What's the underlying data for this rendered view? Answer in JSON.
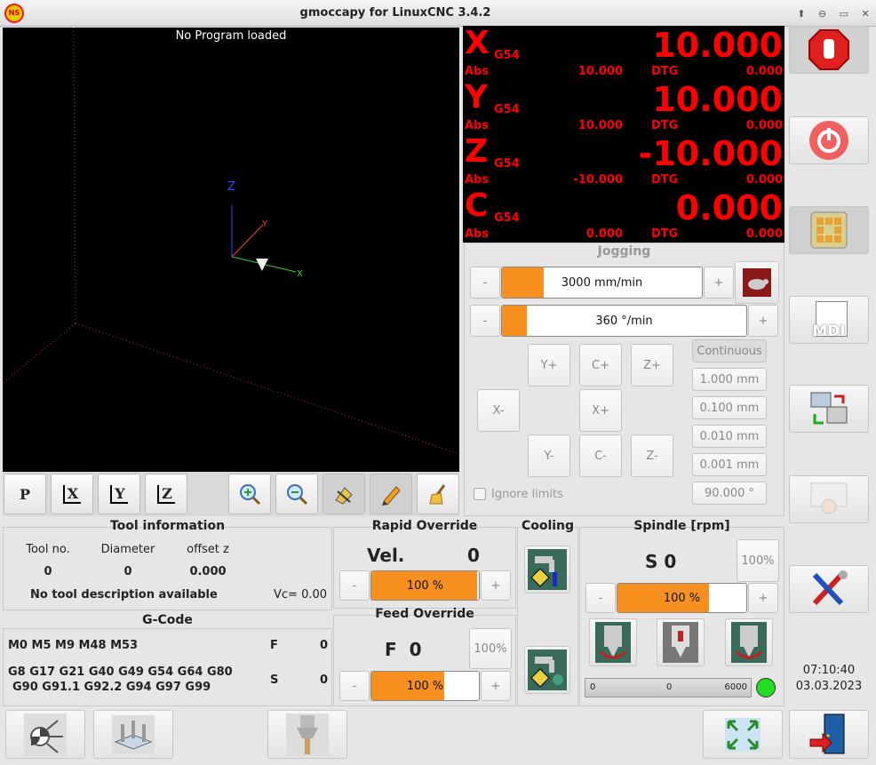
{
  "window": {
    "title": "gmoccapy for LinuxCNC  3.4.2",
    "app_icon": "NS",
    "controls": [
      "⬆",
      "⊖",
      "▭",
      "✕"
    ]
  },
  "preview": {
    "status": "No Program loaded",
    "axis_labels": {
      "z": "Z",
      "y": "Y",
      "x": "X"
    }
  },
  "view_buttons": {
    "perspective": "P",
    "x": "X",
    "y": "Y",
    "z": "Z"
  },
  "dro": [
    {
      "axis": "X",
      "coord": "G54",
      "value": "10.000",
      "abs_label": "Abs",
      "abs": "10.000",
      "dtg_label": "DTG",
      "dtg": "0.000"
    },
    {
      "axis": "Y",
      "coord": "G54",
      "value": "10.000",
      "abs_label": "Abs",
      "abs": "10.000",
      "dtg_label": "DTG",
      "dtg": "0.000"
    },
    {
      "axis": "Z",
      "coord": "G54",
      "value": "-10.000",
      "abs_label": "Abs",
      "abs": "-10.000",
      "dtg_label": "DTG",
      "dtg": "0.000"
    },
    {
      "axis": "C",
      "coord": "G54",
      "value": "0.000",
      "abs_label": "Abs",
      "abs": "0.000",
      "dtg_label": "DTG",
      "dtg": "0.000"
    }
  ],
  "jogging": {
    "title": "Jogging",
    "linear_speed": "3000 mm/min",
    "linear_fill": 0.21,
    "angular_speed": "360 °/min",
    "angular_fill": 0.1,
    "minus": "-",
    "plus": "+",
    "buttons": {
      "yp": "Y+",
      "cp": "C+",
      "zp": "Z+",
      "xm": "X-",
      "xp": "X+",
      "ym": "Y-",
      "cm": "C-",
      "zm": "Z-"
    },
    "increments": [
      "Continuous",
      "1.000 mm",
      "0.100 mm",
      "0.010 mm",
      "0.001 mm",
      "90.000 °"
    ],
    "ignore_limits": "Ignore limits"
  },
  "tool_info": {
    "title": "Tool information",
    "h_tool": "Tool no.",
    "h_diam": "Diameter",
    "h_off": "offset z",
    "tool": "0",
    "diam": "0",
    "off": "0.000",
    "desc": "No tool description available",
    "vc": "Vc= 0.00"
  },
  "gcode": {
    "title": "G-Code",
    "mcodes": "M0 M5 M9 M48 M53",
    "gcodes1": "G8 G17 G21 G40 G49 G54 G64 G80",
    "gcodes2": "G90 G91.1 G92.2 G94 G97 G99",
    "f_label": "F",
    "f_val": "0",
    "s_label": "S",
    "s_val": "0"
  },
  "rapid": {
    "title": "Rapid Override",
    "vel_label": "Vel.",
    "vel": "0",
    "pct": "100 %",
    "fill": 0.98
  },
  "feed": {
    "title": "Feed Override",
    "f_label": "F  0",
    "pct": "100 %",
    "fill": 0.68,
    "reset": "100%"
  },
  "cooling": {
    "title": "Cooling"
  },
  "spindle": {
    "title": "Spindle [rpm]",
    "s_label": "S 0",
    "reset": "100%",
    "pct": "100 %",
    "fill": 0.71,
    "bar_min": "0",
    "bar_mid": "0",
    "bar_max": "6000",
    "status_color": "#22dd22"
  },
  "clock": {
    "time": "07:10:40",
    "date": "03.03.2023"
  },
  "right_buttons": {
    "mdi": "MDI"
  },
  "colors": {
    "dro_red": "#ff0000",
    "accent": "#f7901e"
  }
}
